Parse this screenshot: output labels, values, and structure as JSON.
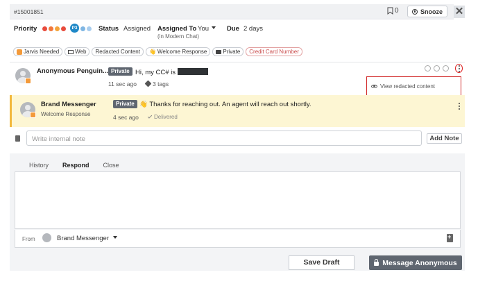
{
  "header": {
    "ticket_id": "#15001851",
    "bookmark_count": "0",
    "snooze_label": "Snooze",
    "close_icon": "close-icon",
    "close_glyph": "✕"
  },
  "properties": {
    "priority_label": "Priority",
    "priority_value": "P3",
    "priority_dot_colors": [
      "#e84b3c",
      "#f2783a",
      "#f3a43b",
      "#1e88c7",
      "#7fb6e3",
      "#a8cdee"
    ],
    "status_label": "Status",
    "status_value": "Assigned",
    "assigned_label": "Assigned To",
    "assigned_value": "You",
    "assigned_sub": "(in Modern Chat)",
    "due_label": "Due",
    "due_value": "2 days"
  },
  "tags": [
    {
      "label": "Jarvis Needed",
      "icon": "jarvis-icon"
    },
    {
      "label": "Web",
      "icon": "monitor-icon"
    },
    {
      "label": "Redacted Content",
      "icon": ""
    },
    {
      "label": "Welcome Response",
      "icon": "wave-icon"
    },
    {
      "label": "Private",
      "icon": "lock-icon"
    },
    {
      "label": "Credit Card Number",
      "icon": ""
    }
  ],
  "messages": [
    {
      "sender": "Anonymous Penguin...",
      "badge": "Private",
      "text": "Hi, my CC# is",
      "time": "11 sec ago",
      "tags": "3 tags",
      "status": ""
    },
    {
      "sender": "Brand Messenger",
      "subtitle": "Welcome Response",
      "badge": "Private",
      "emoji": "👋",
      "text": "Thanks for reaching out. An agent will reach out shortly.",
      "time": "4 sec ago",
      "status": "Delivered"
    }
  ],
  "redacted_popup": {
    "label": "View redacted content",
    "accent": "#d22b2b"
  },
  "note": {
    "placeholder": "Write internal note",
    "button": "Add Note"
  },
  "composer": {
    "tabs": [
      {
        "label": "History",
        "active": false
      },
      {
        "label": "Respond",
        "active": true
      },
      {
        "label": "Close",
        "active": false
      }
    ],
    "from_label": "From",
    "from_value": "Brand Messenger"
  },
  "footer": {
    "save_draft": "Save Draft",
    "send": "Message Anonymous"
  },
  "colors": {
    "highlight_bg": "#fdf6d3",
    "highlight_border": "#f3b83c",
    "active_tab": "#1e6fd9",
    "badge_bg": "#5f6670"
  }
}
